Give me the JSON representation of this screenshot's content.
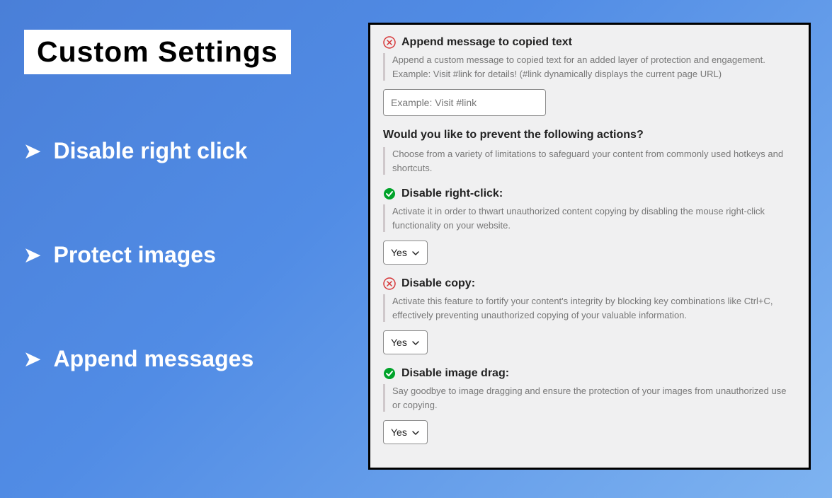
{
  "left": {
    "title": "Custom Settings",
    "features": [
      "Disable right click",
      "Protect images",
      "Append messages"
    ]
  },
  "panel": {
    "append_msg": {
      "status": "error",
      "title": "Append message to copied text",
      "desc_line1": "Append a custom message to copied text for an added layer of protection and engagement.",
      "desc_line2": "Example: Visit #link for details! (#link dynamically displays the current page URL)",
      "placeholder": "Example: Visit #link"
    },
    "prevent_question": {
      "title": "Would you like to prevent the following actions?",
      "desc": "Choose from a variety of limitations to safeguard your content from commonly used hotkeys and shortcuts."
    },
    "right_click": {
      "status": "success",
      "title": "Disable right-click:",
      "desc": "Activate it in order to thwart unauthorized content copying by disabling the mouse right-click functionality on your website.",
      "value": "Yes"
    },
    "disable_copy": {
      "status": "error",
      "title": "Disable copy:",
      "desc": "Activate this feature to fortify your content's integrity by blocking key combinations like Ctrl+C, effectively preventing unauthorized copying of your valuable information.",
      "value": "Yes"
    },
    "image_drag": {
      "status": "success",
      "title": "Disable image drag:",
      "desc": "Say goodbye to image dragging and ensure the protection of your images from unauthorized use or copying.",
      "value": "Yes"
    }
  }
}
